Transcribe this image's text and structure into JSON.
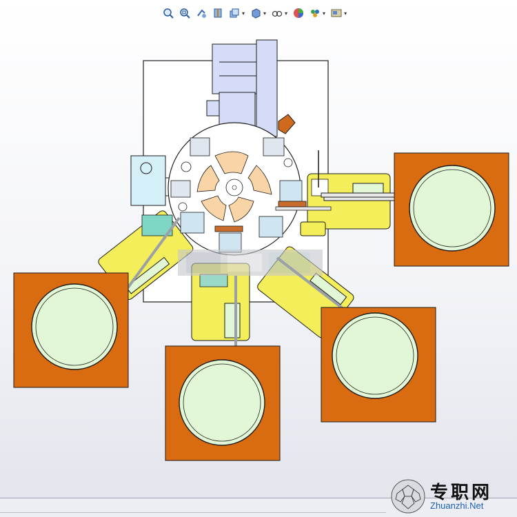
{
  "toolbar": {
    "items": [
      {
        "name": "zoom-to-fit-icon",
        "has_dropdown": false
      },
      {
        "name": "zoom-to-area-icon",
        "has_dropdown": false
      },
      {
        "name": "previous-view-icon",
        "has_dropdown": false
      },
      {
        "name": "section-view-icon",
        "has_dropdown": false
      },
      {
        "name": "view-orientation-icon",
        "has_dropdown": true
      },
      {
        "name": "display-style-icon",
        "has_dropdown": true
      },
      {
        "name": "hide-show-items-icon",
        "has_dropdown": true
      },
      {
        "name": "edit-appearance-icon",
        "has_dropdown": false
      },
      {
        "name": "apply-scene-icon",
        "has_dropdown": true
      },
      {
        "name": "view-settings-icon",
        "has_dropdown": true
      }
    ]
  },
  "watermark": {
    "site_name_cn": "专职网",
    "site_url": "Zhuanzhi.Net"
  },
  "colors": {
    "plate": "#d96b10",
    "bowl": "#e2f7d6",
    "bracket": "#f3ee5a",
    "turntable": "#ffffff",
    "pad": "#f8d4a6",
    "base": "#ffffff",
    "motor": "#d5dcf8",
    "box": "#d6f0fa",
    "outline": "#1a1a1a"
  }
}
